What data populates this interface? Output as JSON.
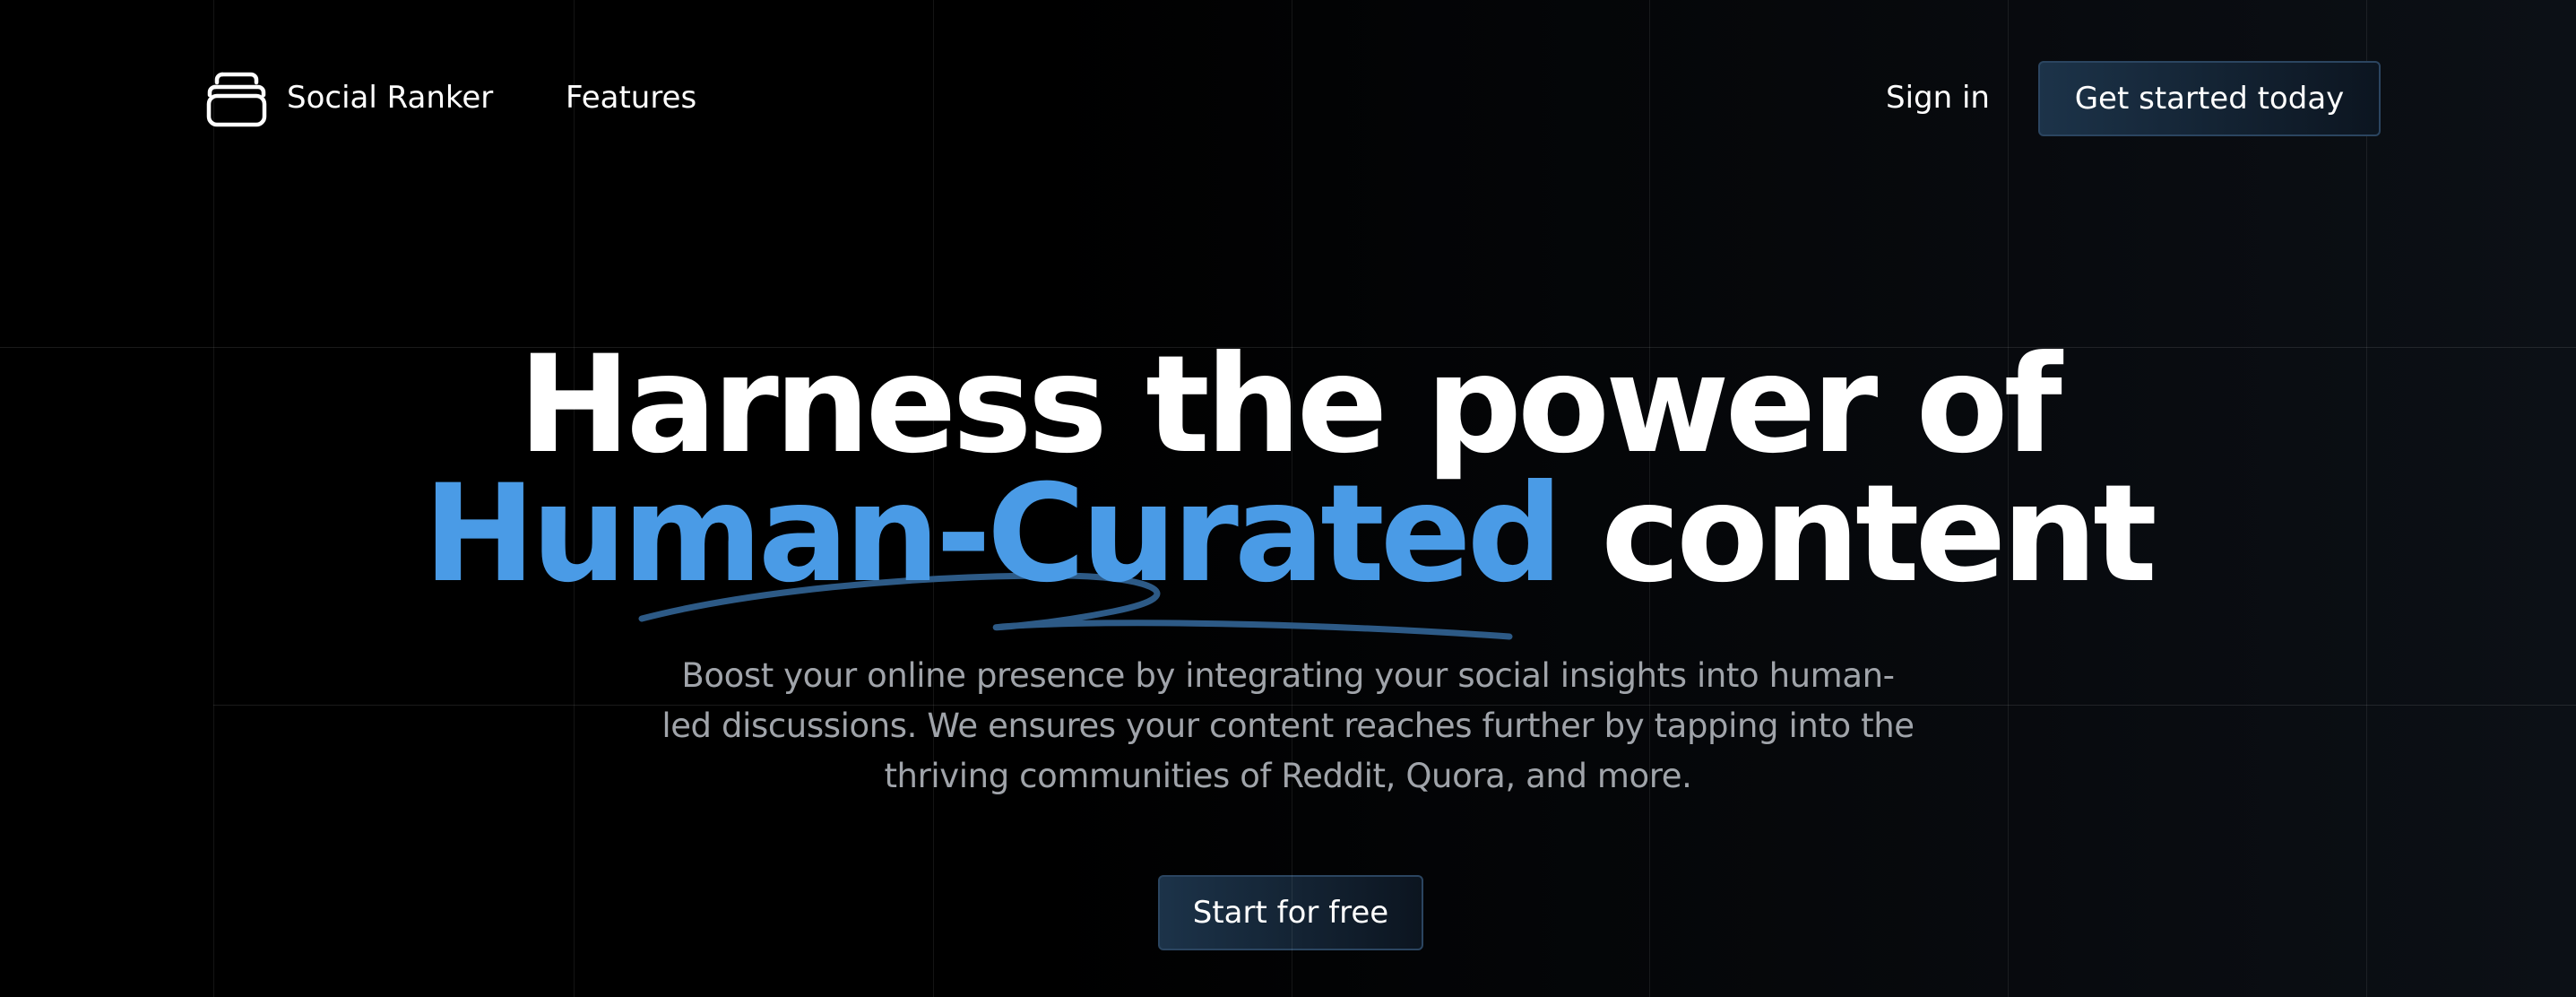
{
  "nav": {
    "brand": "Social Ranker",
    "features": "Features",
    "sign_in": "Sign in",
    "cta": "Get started today",
    "logo_icon": "stacked-cards-icon"
  },
  "hero": {
    "line1": "Harness the power of",
    "line2_accent": "Human-Curated",
    "line2_rest": "content",
    "subtitle": "Boost your online presence by integrating your social insights into human-led discussions. We ensures your content reaches further by tapping into the thriving communities of Reddit, Quora, and more.",
    "cta": "Start for free"
  },
  "colors": {
    "background": "#000000",
    "accent": "#4a9be6",
    "button_bg": "#1c3349",
    "button_border": "#2b4560",
    "subtitle": "#a0a4aa"
  }
}
